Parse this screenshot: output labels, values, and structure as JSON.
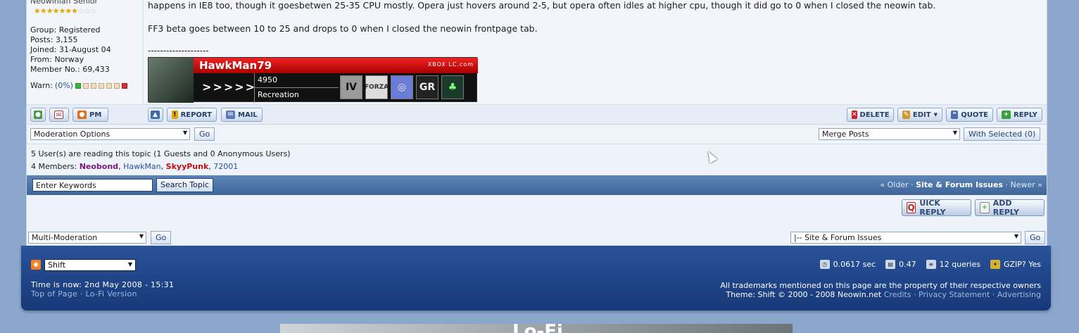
{
  "user": {
    "rank": "Neowinian Senior",
    "stars_on": 7,
    "stars_off": 3,
    "group": "Group: Registered",
    "posts": "Posts: 3,155",
    "joined": "Joined: 31-August 04",
    "from": "From: Norway",
    "member_no": "Member No.: 69,433",
    "warn_label": "Warn:",
    "warn_pct": "(0%)"
  },
  "post": {
    "line1": "happens in IE8 too, though it goesbetwen 25-35 CPU mostly. Opera just hovers around 2-5, but opera often idles at higher cpu, though it did go to 0 when I closed the neowin tab.",
    "line2": "FF3 beta goes between 10 to 25 and drops to 0 when I closed the neowin frontpage tab.",
    "sig_sep": "--------------------"
  },
  "gamercard": {
    "gamertag": "HawkMan79",
    "brand": "XBOX LC.com",
    "arrows": ">>>>>",
    "score": "4950",
    "zone": "Recreation",
    "tiles": [
      "IV",
      "FORZA",
      "◎",
      "GR",
      "♣"
    ]
  },
  "buttons": {
    "report": "REPORT",
    "mail": "MAIL",
    "pm": "PM",
    "delete": "DELETE",
    "edit": "EDIT",
    "quote": "QUOTE",
    "reply": "REPLY"
  },
  "moderation": {
    "options_value": "Moderation Options",
    "go": "Go",
    "merge_value": "Merge Posts",
    "with_selected": "With Selected (0)"
  },
  "readers": {
    "summary": "5 User(s) are reading this topic (1 Guests and 0 Anonymous Users)",
    "members_label": "4 Members:",
    "m1": "Neobond",
    "m2": "HawkMan",
    "m3": "SkyyPunk",
    "m4": "72001"
  },
  "search": {
    "keywords": "Enter Keywords",
    "button": "Search Topic",
    "older": "« Older",
    "forum": "Site & Forum Issues",
    "newer": "Newer »",
    "dot": "·"
  },
  "quick": {
    "quick_reply_q": "Q",
    "quick_reply": "UICK REPLY",
    "add_reply": "ADD REPLY"
  },
  "bottom": {
    "multimod": "Multi-Moderation",
    "go": "Go",
    "jump": "|-- Site & Forum Issues"
  },
  "footer": {
    "skin": "Shift",
    "time": "Time is now: 2nd May 2008 - 15:31",
    "top": "Top of Page",
    "lofi": "Lo-Fi Version",
    "sep": "·",
    "exec": "0.0617 sec",
    "load": "0.47",
    "queries": "12 queries",
    "gzip": "GZIP? Yes",
    "trademark": "All trademarks mentioned on this page are the property of their respective owners",
    "theme": "Theme: Shift © 2000 - 2008 Neowin.net",
    "credits": "Credits",
    "privacy": "Privacy Statement",
    "advertising": "Advertising"
  },
  "banner_text": "Lo-Fi"
}
